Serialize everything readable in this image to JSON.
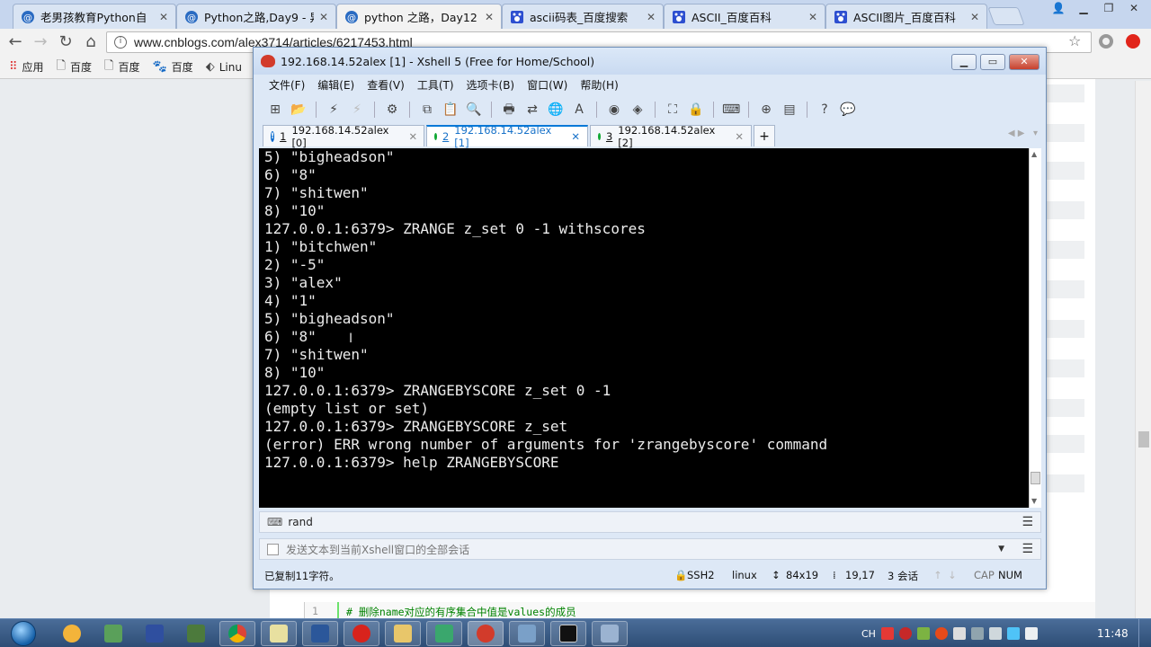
{
  "browser": {
    "tabs": [
      {
        "title": "老男孩教育Python自"
      },
      {
        "title": "Python之路,Day9 - 异"
      },
      {
        "title": "python 之路，Day12"
      },
      {
        "title": "ascii码表_百度搜索"
      },
      {
        "title": "ASCII_百度百科"
      },
      {
        "title": "ASCII图片_百度百科"
      }
    ],
    "url": "www.cnblogs.com/alex3714/articles/6217453.html",
    "bookmarks": [
      {
        "label": "应用",
        "icon": "apps-grid-icon"
      },
      {
        "label": "百度",
        "icon": "page-icon"
      },
      {
        "label": "百度",
        "icon": "page-icon"
      },
      {
        "label": "百度",
        "icon": "baidu-paw-icon"
      },
      {
        "label": "Linu",
        "icon": "bookmark-icon"
      }
    ]
  },
  "xshell": {
    "title": "192.168.14.52alex [1] - Xshell 5 (Free for Home/School)",
    "menu": [
      "文件(F)",
      "编辑(E)",
      "查看(V)",
      "工具(T)",
      "选项卡(B)",
      "窗口(W)",
      "帮助(H)"
    ],
    "tabs": [
      {
        "num": "1",
        "label": "192.168.14.52alex [0]",
        "status": "warning"
      },
      {
        "num": "2",
        "label": "192.168.14.52alex [1]",
        "status": "connected"
      },
      {
        "num": "3",
        "label": "192.168.14.52alex [2]",
        "status": "connected"
      }
    ],
    "terminal_lines": [
      "5) \"bigheadson\"",
      "6) \"8\"",
      "7) \"shitwen\"",
      "8) \"10\"",
      "127.0.0.1:6379> ZRANGE z_set 0 -1 withscores",
      "1) \"bitchwen\"",
      "2) \"-5\"",
      "3) \"alex\"",
      "4) \"1\"",
      "5) \"bigheadson\"",
      "6) \"8\"",
      "7) \"shitwen\"",
      "8) \"10\"",
      "127.0.0.1:6379> ZRANGEBYSCORE z_set 0 -1",
      "(empty list or set)",
      "127.0.0.1:6379> ZRANGEBYSCORE z_set",
      "(error) ERR wrong number of arguments for 'zrangebyscore' command",
      "127.0.0.1:6379> help ZRANGEBYSCORE"
    ],
    "command_bar": "rand",
    "send_placeholder": "发送文本到当前Xshell窗口的全部会话",
    "status": {
      "message": "已复制11字符。",
      "protocol": "SSH2",
      "os": "linux",
      "size": "84x19",
      "position": "19,17",
      "sessions": "3 会话",
      "cap": "CAP",
      "num": "NUM"
    }
  },
  "webpage": {
    "code_line_number": "1",
    "code_comment": "# 删除name对应的有序集合中值是values的成员"
  },
  "taskbar": {
    "lang": "CH",
    "clock": "11:48"
  }
}
